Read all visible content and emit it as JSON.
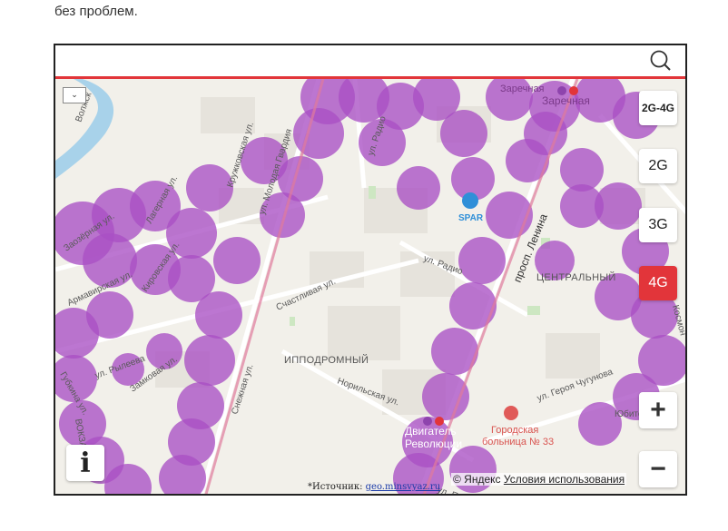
{
  "intro_text": "без проблем.",
  "map": {
    "network_buttons": [
      {
        "label": "2G-4G",
        "active": false
      },
      {
        "label": "2G",
        "active": false
      },
      {
        "label": "3G",
        "active": false
      },
      {
        "label": "4G",
        "active": true
      }
    ],
    "zoom_in_label": "+",
    "zoom_out_label": "−",
    "info_label": "i",
    "layer_dropdown_label": "⌄",
    "source_prefix": "*Источник:",
    "source_link": "geo.minsvyaz.ru",
    "copyright": "© Яндекс",
    "terms": "Условия использования",
    "colors": {
      "coverage": "#a94fc4",
      "accent": "#e2353a"
    },
    "labels": {
      "street_lenina": "просп. Ленина",
      "street_snezhnaya": "Снежная ул.",
      "street_molodaya": "ул. Молодая Гвардия",
      "street_kruzhkovskaya": "Кружковская ул.",
      "street_radio": "ул. Радио",
      "street_radio2": "ул. Радио",
      "street_schastlivaya": "Счастливая ул.",
      "street_norilskaya": "Норильская ул.",
      "street_ryleeva": "ул. Рылеева",
      "street_zamkovaya": "Замковая ул.",
      "street_kirovskaya": "Кировская ул.",
      "street_armavirskaya": "Армавирская ул.",
      "street_zaozernaya": "Заозёрная ул.",
      "street_lagernaya": "Лагерная ул.",
      "street_gubkina": "Губкина ул.",
      "street_chugunova": "ул. Героя Чугунова",
      "street_yubileynaya": "Юбите",
      "street_kosmo": "Космон",
      "street_vokz": "ВОКЗАЛ",
      "street_podl": "ул. Подл",
      "district_ippodromny": "ИППОДРОМНЫЙ",
      "district_central": "ЦЕНТРАЛЬНЫЙ",
      "metro_zarechnaya": "Заречная",
      "metro_zarechnaya2": "Заречная",
      "metro_dvigatel_1": "Двигатель",
      "metro_dvigatel_2": "Революции",
      "poi_spar": "SPAR",
      "hospital_1": "Городская",
      "hospital_2": "больница № 33",
      "street_volzh": "Волжск"
    }
  }
}
